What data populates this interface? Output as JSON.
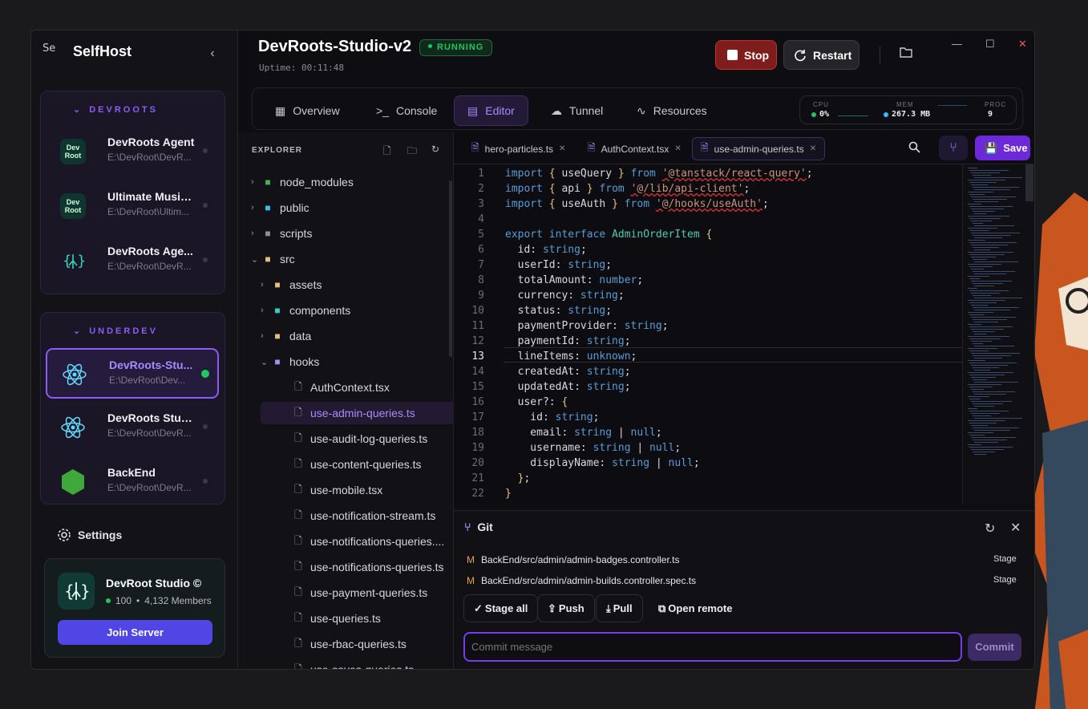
{
  "app": {
    "name": "SelfHost",
    "logo_alt": "Se"
  },
  "sidebar": {
    "groups": [
      {
        "label": "DEVROOTS",
        "projects": [
          {
            "name": "DevRoots Agent",
            "path": "E:\\DevRoot\\DevR...",
            "icon": "devroot-logo"
          },
          {
            "name": "Ultimate Music...",
            "path": "E:\\DevRoot\\Ultim...",
            "icon": "devroot-logo"
          },
          {
            "name": "DevRoots Age...",
            "path": "E:\\DevRoot\\DevR...",
            "icon": "tree-braces-icon"
          }
        ]
      },
      {
        "label": "UNDERDEV",
        "projects": [
          {
            "name": "DevRoots-Stu...",
            "path": "E:\\DevRoot\\Dev...",
            "icon": "react-icon",
            "active": true
          },
          {
            "name": "DevRoots Stud...",
            "path": "E:\\DevRoot\\DevR...",
            "icon": "react-icon"
          },
          {
            "name": "BackEnd",
            "path": "E:\\DevRoot\\DevR...",
            "icon": "nodejs-icon"
          }
        ]
      }
    ],
    "settings_label": "Settings",
    "community": {
      "name": "DevRoot Studio ©",
      "online": "100",
      "members": "4,132 Members",
      "join_label": "Join Server"
    }
  },
  "header": {
    "project_title": "DevRoots-Studio-v2",
    "status": "RUNNING",
    "uptime": "Uptime: 00:11:48",
    "stop_label": "Stop",
    "restart_label": "Restart"
  },
  "tabs": [
    {
      "label": "Overview",
      "icon": "grid-icon"
    },
    {
      "label": "Console",
      "icon": "terminal-icon"
    },
    {
      "label": "Editor",
      "icon": "file-code-icon",
      "active": true
    },
    {
      "label": "Tunnel",
      "icon": "cloud-icon"
    },
    {
      "label": "Resources",
      "icon": "activity-icon"
    }
  ],
  "stats": {
    "cpu_label": "CPU",
    "cpu_value": "0%",
    "mem_label": "MEM",
    "mem_value": "267.3 MB",
    "proc_label": "PROC",
    "proc_value": "9"
  },
  "explorer": {
    "title": "EXPLORER",
    "items": [
      {
        "label": "node_modules",
        "type": "folder"
      },
      {
        "label": "public",
        "type": "folder"
      },
      {
        "label": "scripts",
        "type": "folder"
      },
      {
        "label": "src",
        "type": "folder-open"
      },
      {
        "label": "assets",
        "type": "folder"
      },
      {
        "label": "components",
        "type": "folder"
      },
      {
        "label": "data",
        "type": "folder"
      },
      {
        "label": "hooks",
        "type": "folder-open"
      },
      {
        "label": "AuthContext.tsx",
        "type": "file"
      },
      {
        "label": "use-admin-queries.ts",
        "type": "file",
        "selected": true
      },
      {
        "label": "use-audit-log-queries.ts",
        "type": "file"
      },
      {
        "label": "use-content-queries.ts",
        "type": "file"
      },
      {
        "label": "use-mobile.tsx",
        "type": "file"
      },
      {
        "label": "use-notification-stream.ts",
        "type": "file"
      },
      {
        "label": "use-notifications-queries....",
        "type": "file"
      },
      {
        "label": "use-notifications-queries.ts",
        "type": "file"
      },
      {
        "label": "use-payment-queries.ts",
        "type": "file"
      },
      {
        "label": "use-queries.ts",
        "type": "file"
      },
      {
        "label": "use-rbac-queries.ts",
        "type": "file"
      },
      {
        "label": "use-saves-queries.ts",
        "type": "file"
      }
    ]
  },
  "editor": {
    "tabs": [
      {
        "label": "hero-particles.ts"
      },
      {
        "label": "AuthContext.tsx"
      },
      {
        "label": "use-admin-queries.ts",
        "active": true
      }
    ],
    "save_label": "Save",
    "current_line": 13,
    "lines": [
      "import { useQuery } from '@tanstack/react-query';",
      "import { api } from '@/lib/api-client';",
      "import { useAuth } from '@/hooks/useAuth';",
      "",
      "export interface AdminOrderItem {",
      "  id: string;",
      "  userId: string;",
      "  totalAmount: number;",
      "  currency: string;",
      "  status: string;",
      "  paymentProvider: string;",
      "  paymentId: string;",
      "  lineItems: unknown;",
      "  createdAt: string;",
      "  updatedAt: string;",
      "  user?: {",
      "    id: string;",
      "    email: string | null;",
      "    username: string | null;",
      "    displayName: string | null;",
      "  };",
      "}"
    ]
  },
  "git": {
    "title": "Git",
    "changes": [
      {
        "status": "M",
        "path": "BackEnd/src/admin/admin-badges.controller.ts",
        "action": "Stage"
      },
      {
        "status": "M",
        "path": "BackEnd/src/admin/admin-builds.controller.spec.ts",
        "action": "Stage"
      }
    ],
    "stage_all": "Stage all",
    "push": "Push",
    "pull": "Pull",
    "open_remote": "Open remote",
    "commit_placeholder": "Commit message",
    "commit_label": "Commit"
  }
}
